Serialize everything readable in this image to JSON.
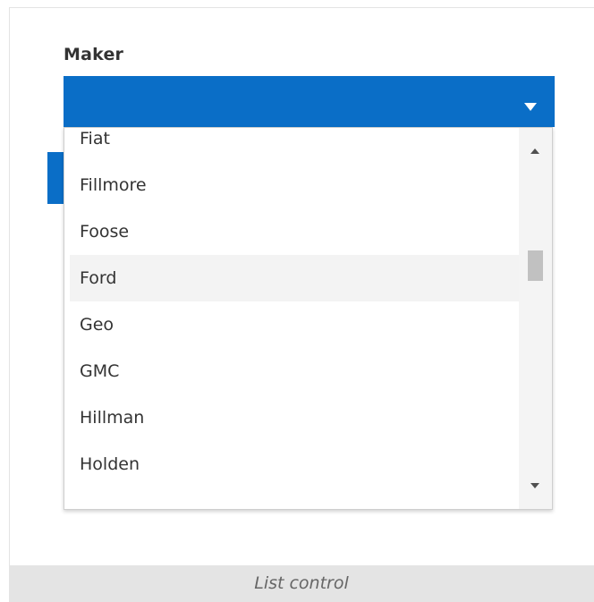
{
  "field": {
    "label": "Maker",
    "caret_icon": "caret-down-icon"
  },
  "dropdown": {
    "options": [
      {
        "label": "Fiat"
      },
      {
        "label": "Fillmore"
      },
      {
        "label": "Foose"
      },
      {
        "label": "Ford"
      },
      {
        "label": "Geo"
      },
      {
        "label": "GMC"
      },
      {
        "label": "Hillman"
      },
      {
        "label": "Holden"
      }
    ],
    "hovered": "Ford",
    "scroll_up_icon": "triangle-up-icon",
    "scroll_down_icon": "triangle-down-icon"
  },
  "caption": "List control",
  "colors": {
    "accent": "#0a6ec7",
    "hover_row": "#f3f3f3",
    "scroll_track": "#f4f4f4",
    "scroll_thumb": "#c1c1c1",
    "caption_bg": "#e4e4e4"
  }
}
